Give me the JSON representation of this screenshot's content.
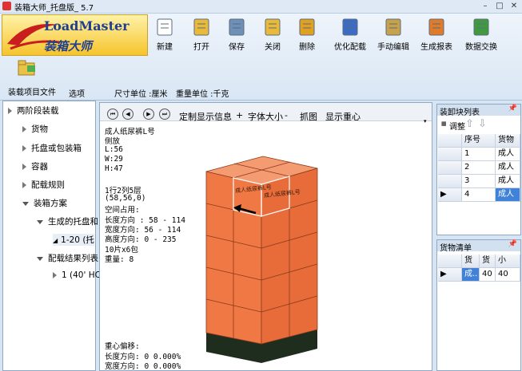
{
  "window": {
    "title": "装箱大师_托盘版_ 5.7",
    "minimize": "–",
    "maximize": "□",
    "close": "✕"
  },
  "logo": {
    "title": "LoadMaster",
    "subtitle": "装箱大师"
  },
  "toolbar": [
    {
      "label": "新建",
      "icon": "new-file-icon"
    },
    {
      "label": "打开",
      "icon": "open-folder-icon"
    },
    {
      "label": "保存",
      "icon": "save-icon"
    },
    {
      "label": "关闭",
      "icon": "close-folder-icon"
    },
    {
      "label": "删除",
      "icon": "delete-icon"
    },
    {
      "label": "优化配载",
      "icon": "optimize-icon"
    },
    {
      "label": "手动编辑",
      "icon": "manual-edit-icon"
    },
    {
      "label": "生成报表",
      "icon": "report-icon"
    },
    {
      "label": "数据交换",
      "icon": "excel-icon"
    }
  ],
  "ribbon_small": {
    "project_file": "装载项目文件",
    "options": "选项",
    "size_unit": "尺寸单位 :厘米",
    "weight_unit": "重量单位 :千克"
  },
  "tree": {
    "root": "两阶段装载",
    "items": [
      "货物",
      "托盘或包装箱",
      "容器",
      "配载规则",
      "装箱方案",
      "生成的托盘和",
      "1-20 (托",
      "配载结果列表",
      "1 (40' HC"
    ]
  },
  "viewer_toolbar": {
    "first": "⏮",
    "prev": "◀",
    "next": "▶",
    "last": "⏭",
    "custom": "定制显示信息",
    "plus": "+",
    "font": "字体大小",
    "minus": "-",
    "capture": "抓图",
    "center": "显示重心"
  },
  "info": {
    "lines": [
      "成人纸尿裤L号",
      "侧放",
      "L:56",
      "W:29",
      "H:47",
      "",
      "1行2列5层",
      "(58,56,0)",
      "空间占用:",
      "长度方向 : 58 - 114",
      "宽度方向: 56 - 114",
      "高度方向: 0 - 235",
      "10片x6包",
      "重量:  8"
    ],
    "cog_lines": [
      "重心偏移:",
      "长度方向: 0  0.000%",
      "宽度方向: 0  0.000%"
    ],
    "box_label": "成人纸尿裤L号"
  },
  "load_list": {
    "title": "装卸块列表",
    "adjust": "调整",
    "headers": [
      "序号",
      "货物"
    ],
    "rows": [
      [
        "1",
        "成人"
      ],
      [
        "2",
        "成人"
      ],
      [
        "3",
        "成人"
      ],
      [
        "4",
        "成人"
      ]
    ],
    "selected": 3
  },
  "cargo_list": {
    "title": "货物清单",
    "headers": [
      "货",
      "货",
      "小"
    ],
    "rows": [
      [
        "成..",
        "40",
        "40"
      ]
    ]
  }
}
